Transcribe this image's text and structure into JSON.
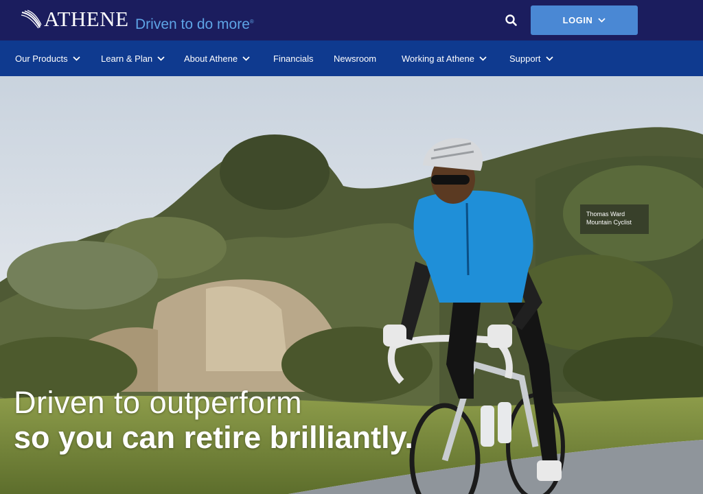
{
  "brand": {
    "logo_text": "ATHENE",
    "tagline": "Driven to do more",
    "tagline_mark": "®",
    "colors": {
      "header_bg": "#1b1d5e",
      "nav_bg": "#0f3a8f",
      "accent": "#4a88d4",
      "tagline": "#5ea4e6"
    }
  },
  "header": {
    "search_icon": "search-icon",
    "login_label": "LOGIN"
  },
  "nav": {
    "items": [
      {
        "label": "Our Products",
        "has_menu": true
      },
      {
        "label": "Learn & Plan",
        "has_menu": true
      },
      {
        "label": "About Athene",
        "has_menu": true
      },
      {
        "label": "Financials",
        "has_menu": false
      },
      {
        "label": "Newsroom",
        "has_menu": false
      },
      {
        "label": "Working at Athene",
        "has_menu": true
      },
      {
        "label": "Support",
        "has_menu": true
      }
    ]
  },
  "hero": {
    "caption_name": "Thomas Ward",
    "caption_role": "Mountain Cyclist",
    "headline_line1": "Driven to outperform",
    "headline_line2": "so you can retire brilliantly."
  }
}
